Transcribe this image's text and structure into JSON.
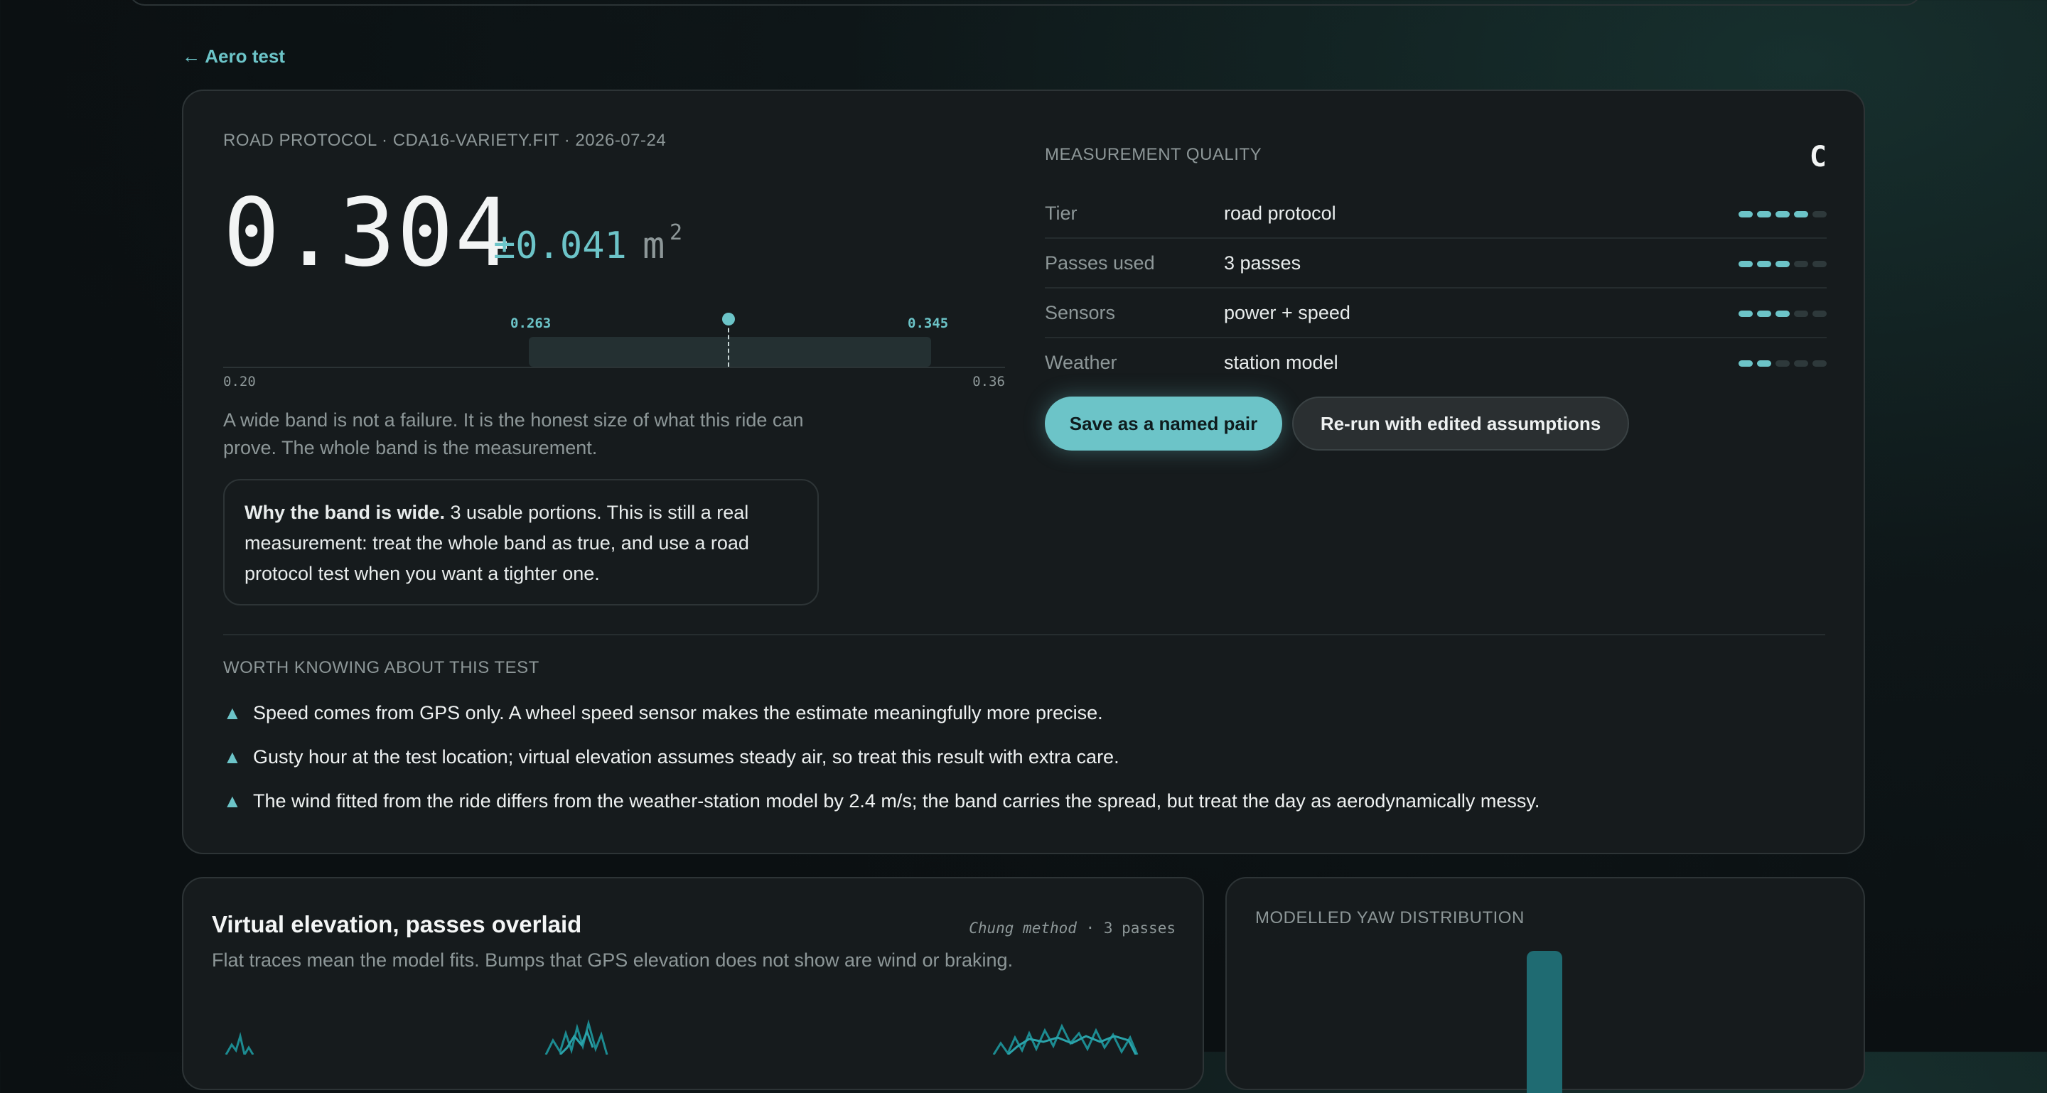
{
  "nav": {
    "back_label": "← Aero test"
  },
  "result": {
    "meta": "ROAD PROTOCOL · CDA16-VARIETY.FIT · 2026-07-24",
    "value": "0.304",
    "uncertainty": "±0.041",
    "unit": "m",
    "unit_exp": "2",
    "band_low": "0.263",
    "band_high": "0.345",
    "axis_min": "0.20",
    "axis_max": "0.36",
    "note": "A wide band is not a failure. It is the honest size of what this ride can prove. The whole band is the measurement.",
    "why_title": "Why the band is wide.",
    "why_text": " 3 usable portions. This is still a real measurement: treat the whole band as true, and use a road protocol test when you want a tighter one."
  },
  "quality": {
    "title": "MEASUREMENT QUALITY",
    "grade": "C",
    "rows": [
      {
        "label": "Tier",
        "value": "road protocol",
        "level": 4
      },
      {
        "label": "Passes used",
        "value": "3 passes",
        "level": 3
      },
      {
        "label": "Sensors",
        "value": "power + speed",
        "level": 3
      },
      {
        "label": "Weather",
        "value": "station model",
        "level": 2
      }
    ],
    "max_level": 5
  },
  "actions": {
    "save_label": "Save as a named pair",
    "rerun_label": "Re-run with edited assumptions"
  },
  "notes": {
    "title": "WORTH KNOWING ABOUT THIS TEST",
    "items": [
      "Speed comes from GPS only. A wheel speed sensor makes the estimate meaningfully more precise.",
      "Gusty hour at the test location; virtual elevation assumes steady air, so treat this result with extra care.",
      "The wind fitted from the ride differs from the weather-station model by 2.4 m/s; the band carries the spread, but treat the day as aerodynamically messy."
    ]
  },
  "ve_card": {
    "title": "Virtual elevation, passes overlaid",
    "subtitle": "Flat traces mean the model fits. Bumps that GPS elevation does not show are wind or braking.",
    "method": "Chung method",
    "passes": "3 passes"
  },
  "yaw_card": {
    "title": "MODELLED YAW DISTRIBUTION"
  },
  "colors": {
    "accent": "#6cc4c8",
    "background": "#0e1618",
    "card": "#161b1d"
  }
}
